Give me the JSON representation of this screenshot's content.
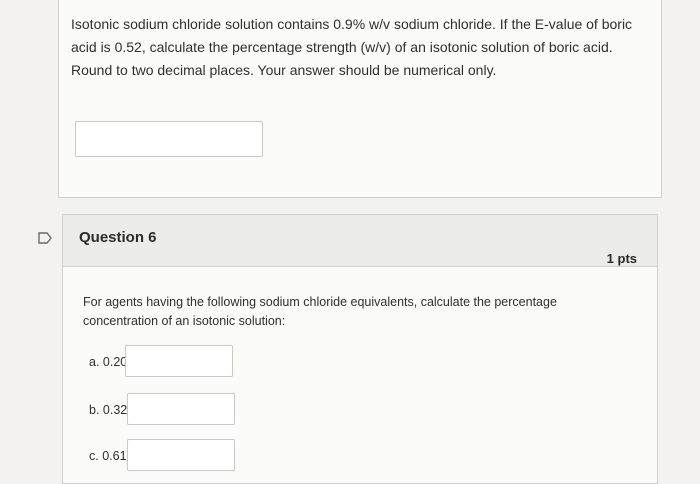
{
  "previous_question": {
    "text": "Isotonic sodium chloride solution contains 0.9% w/v sodium chloride. If the E-value of boric acid is 0.52, calculate the percentage strength (w/v) of an isotonic solution of boric acid. Round to two decimal places. Your answer should be numerical only.",
    "answer_value": ""
  },
  "question6": {
    "title": "Question 6",
    "points": "1 pts",
    "text": "For agents having the following sodium chloride equivalents, calculate the percentage concentration of an isotonic solution:",
    "parts": [
      {
        "label": "a. 0.20",
        "value": ""
      },
      {
        "label": "b. 0.32",
        "value": ""
      },
      {
        "label": "c. 0.61",
        "value": ""
      }
    ]
  },
  "icons": {
    "flag": "flag-outline-icon"
  }
}
